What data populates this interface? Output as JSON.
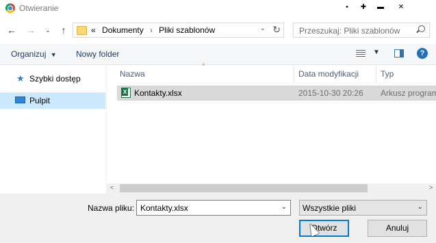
{
  "window": {
    "title": "Otwieranie",
    "controls": [
      "minimize",
      "maximize",
      "pin",
      "close"
    ]
  },
  "navigation": {
    "back_icon": "back-arrow-icon",
    "forward_icon": "forward-arrow-icon",
    "recent_icon": "chevron-down-icon",
    "up_icon": "up-arrow-icon"
  },
  "address": {
    "overflow": "«",
    "crumbs": [
      "Dokumenty",
      "Pliki szablonów"
    ],
    "separator": "›"
  },
  "search": {
    "placeholder": "Przeszukaj: Pliki szablonów"
  },
  "toolbar": {
    "organize_label": "Organizuj",
    "new_folder_label": "Nowy folder"
  },
  "sidebar": {
    "items": [
      {
        "label": "Szybki dostęp",
        "icon": "star-icon"
      },
      {
        "label": "Pulpit",
        "icon": "desktop-icon",
        "selected": true
      }
    ]
  },
  "filelist": {
    "columns": [
      "Nazwa",
      "Data modyfikacji",
      "Typ"
    ],
    "rows": [
      {
        "name": "Kontakty.xlsx",
        "modified": "2015-10-30 20:26",
        "type": "Arkusz program",
        "icon": "xlsx-icon"
      }
    ]
  },
  "bottom": {
    "filename_label": "Nazwa pliku:",
    "filename_value": "Kontakty.xlsx",
    "filetype_value": "Wszystkie pliki",
    "open_label": "Otwórz",
    "cancel_label": "Anuluj"
  },
  "colors": {
    "selection": "#cce8ff",
    "row_highlight": "#d9d9d9",
    "accent": "#0078d7",
    "background": "#f0f0f0"
  }
}
